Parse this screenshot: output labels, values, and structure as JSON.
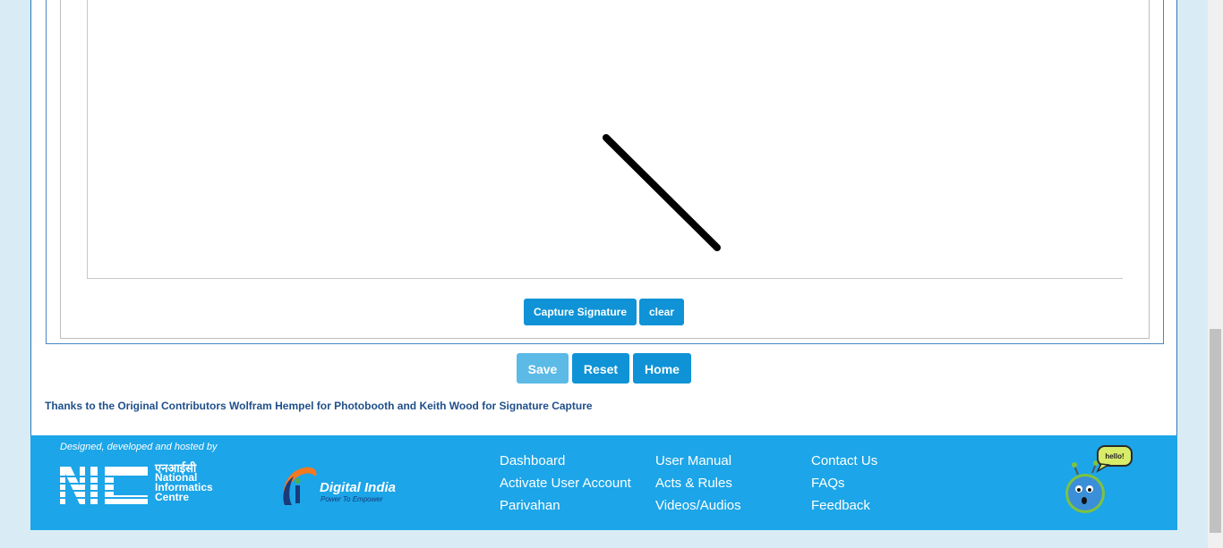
{
  "signature_panel": {
    "capture_label": "Capture Signature",
    "clear_label": "clear"
  },
  "actions": {
    "save_label": "Save",
    "reset_label": "Reset",
    "home_label": "Home"
  },
  "credits": "Thanks to the Original Contributors Wolfram Hempel for Photobooth and Keith Wood for Signature Capture",
  "footer": {
    "designed_by": "Designed, developed and hosted by",
    "nic": {
      "abbr": "NIC",
      "hindi": "एनआईसी",
      "line1": "National",
      "line2": "Informatics",
      "line3": "Centre"
    },
    "digital_india": {
      "name": "Digital India",
      "tagline": "Power To Empower"
    },
    "links_col1": [
      "Dashboard",
      "Activate User Account",
      "Parivahan"
    ],
    "links_col2": [
      "User Manual",
      "Acts & Rules",
      "Videos/Audios"
    ],
    "links_col3": [
      "Contact Us",
      "FAQs",
      "Feedback"
    ],
    "mascot_bubble": "hello!"
  },
  "colors": {
    "button": "#0f93d6",
    "button_disabled": "#5bbae6",
    "footer_bg": "#1ca5e8",
    "credits_text": "#1f4f8a"
  }
}
